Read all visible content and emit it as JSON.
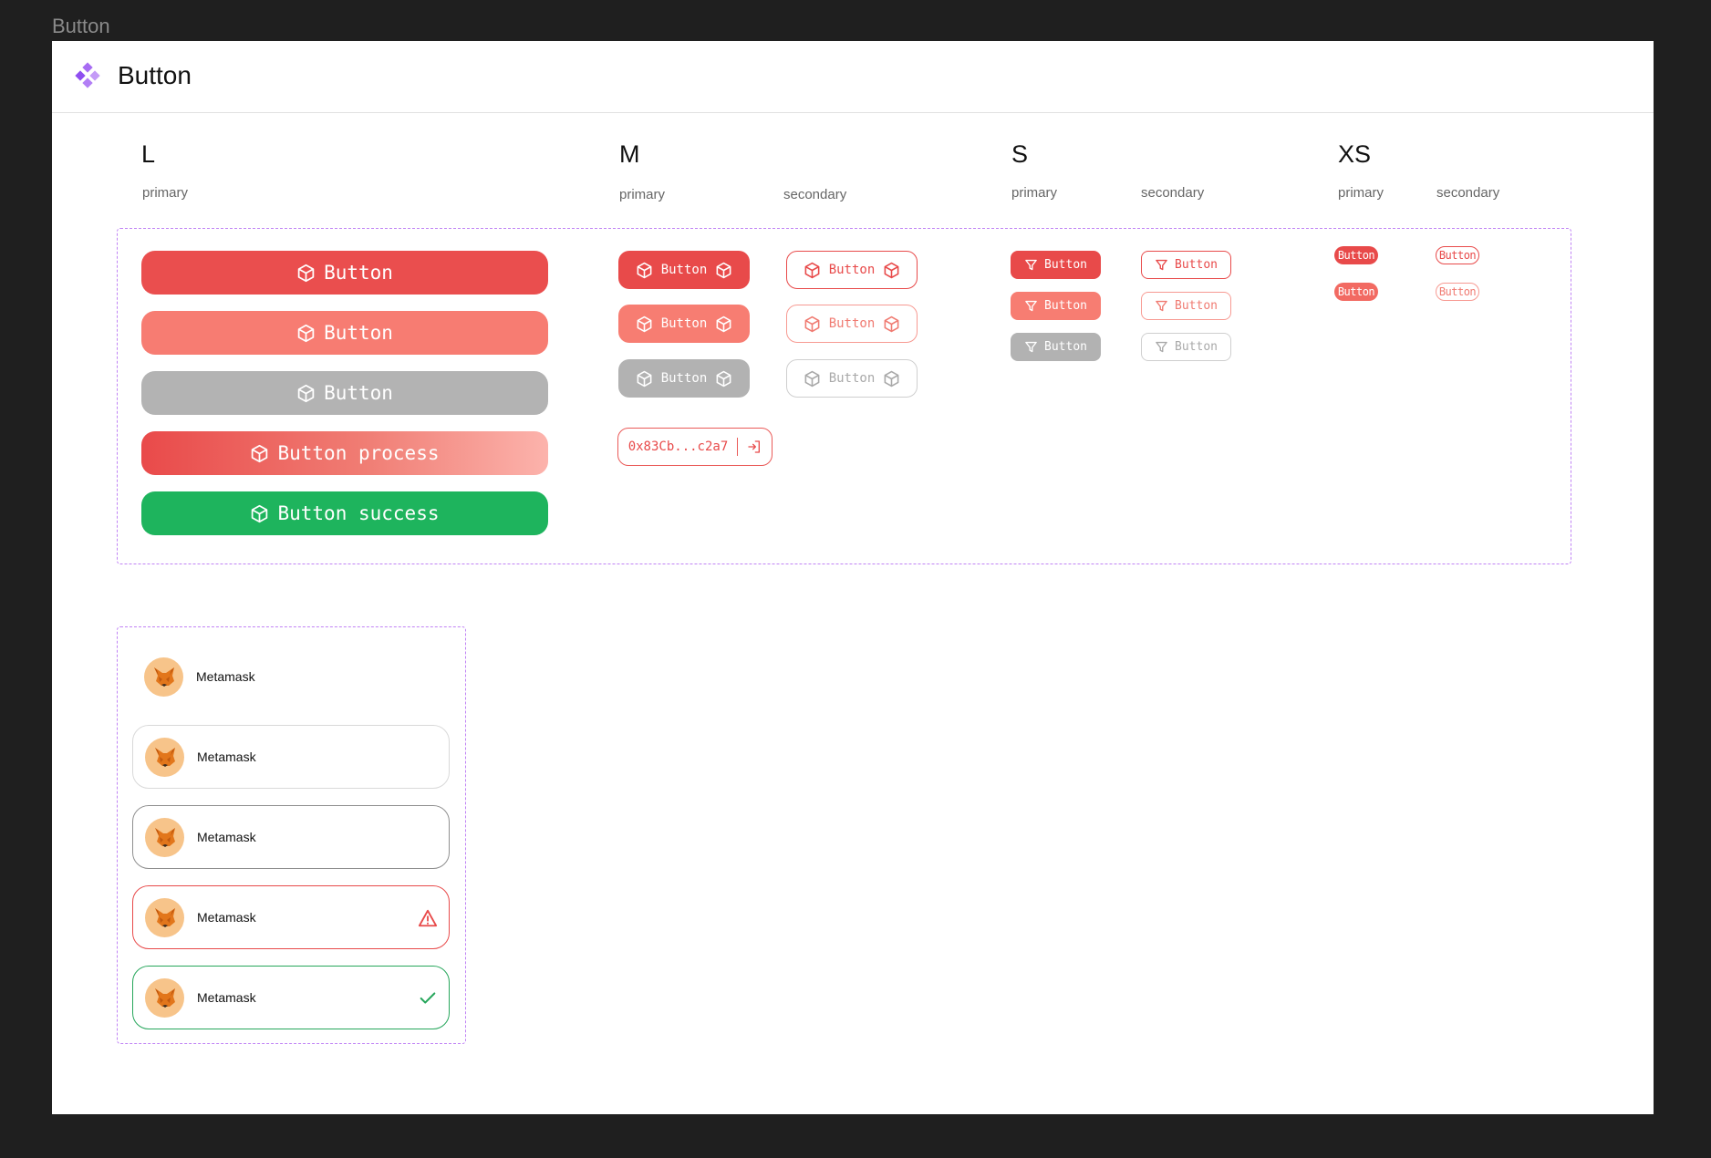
{
  "frame_title": "Button",
  "header": {
    "title": "Button"
  },
  "sizes": {
    "l": {
      "title": "L",
      "primary": "primary"
    },
    "m": {
      "title": "M",
      "primary": "primary",
      "secondary": "secondary"
    },
    "s": {
      "title": "S",
      "primary": "primary",
      "secondary": "secondary"
    },
    "xs": {
      "title": "XS",
      "primary": "primary",
      "secondary": "secondary"
    }
  },
  "buttons": {
    "label": "Button",
    "process_label": "Button process",
    "success_label": "Button success",
    "wallet_address": "0x83Cb...c2a7"
  },
  "wallets": [
    {
      "name": "Metamask",
      "state": "default"
    },
    {
      "name": "Metamask",
      "state": "hover"
    },
    {
      "name": "Metamask",
      "state": "focus"
    },
    {
      "name": "Metamask",
      "state": "error"
    },
    {
      "name": "Metamask",
      "state": "success"
    }
  ],
  "colors": {
    "primary": "#e84a4a",
    "primary_light": "#f77d72",
    "disabled": "#b3b3b3",
    "success": "#1eb45d",
    "outline": "#c083f5"
  },
  "icons": {
    "cube": "cube-icon",
    "filter": "filter-icon",
    "login": "login-icon",
    "warning": "warning-icon",
    "check": "check-icon",
    "fox": "metamask-fox-icon",
    "logo": "component-logo-icon"
  }
}
